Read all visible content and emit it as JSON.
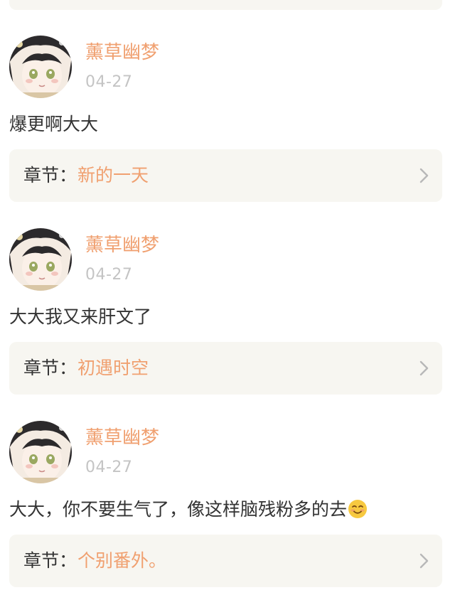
{
  "comments": [
    {
      "username": "薰草幽梦",
      "time": "04-27",
      "content": "爆更啊大大",
      "chapter_label": "章节：",
      "chapter_title": "新的一天"
    },
    {
      "username": "薰草幽梦",
      "time": "04-27",
      "content": "大大我又来肝文了",
      "chapter_label": "章节：",
      "chapter_title": "初遇时空"
    },
    {
      "username": "薰草幽梦",
      "time": "04-27",
      "content": "大大，你不要生气了，像这样脑残粉多的去",
      "content_emoji": "smiling-face-emoji",
      "chapter_label": "章节：",
      "chapter_title": "个别番外。"
    }
  ],
  "colors": {
    "accent": "#f0a070",
    "card_background": "#f7f6f1",
    "text": "#333333",
    "muted": "#c4c4c4"
  },
  "icons": {
    "chevron": "chevron-right-icon",
    "avatar": "anime-avatar-image"
  }
}
